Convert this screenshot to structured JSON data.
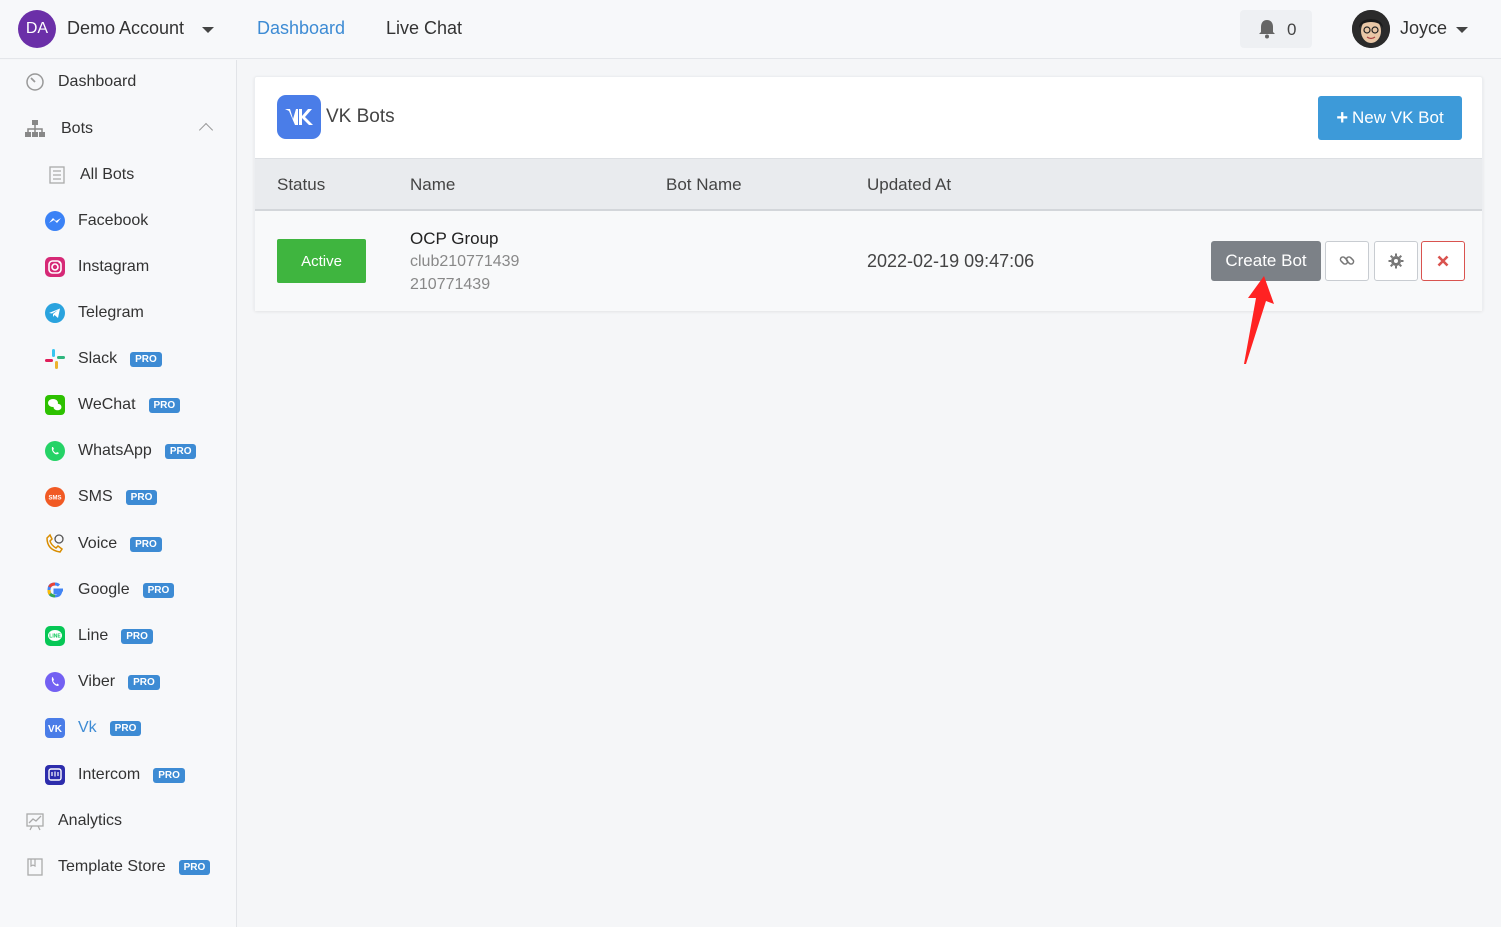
{
  "account": {
    "initials": "DA",
    "name": "Demo Account"
  },
  "topnav": {
    "dashboard": "Dashboard",
    "live_chat": "Live Chat"
  },
  "notifications": {
    "count": "0"
  },
  "user": {
    "name": "Joyce"
  },
  "sidebar": {
    "items": [
      {
        "label": "Dashboard",
        "icon": "dashboard-gauge-icon"
      },
      {
        "label": "Bots",
        "icon": "sitemap-icon"
      },
      {
        "label": "All Bots",
        "icon": "list-icon"
      },
      {
        "label": "Facebook",
        "icon": "messenger-icon"
      },
      {
        "label": "Instagram",
        "icon": "instagram-icon"
      },
      {
        "label": "Telegram",
        "icon": "telegram-icon"
      },
      {
        "label": "Slack",
        "icon": "slack-icon",
        "pro": "PRO"
      },
      {
        "label": "WeChat",
        "icon": "wechat-icon",
        "pro": "PRO"
      },
      {
        "label": "WhatsApp",
        "icon": "whatsapp-icon",
        "pro": "PRO"
      },
      {
        "label": "SMS",
        "icon": "sms-icon",
        "pro": "PRO"
      },
      {
        "label": "Voice",
        "icon": "voice-icon",
        "pro": "PRO"
      },
      {
        "label": "Google",
        "icon": "google-icon",
        "pro": "PRO"
      },
      {
        "label": "Line",
        "icon": "line-icon",
        "pro": "PRO"
      },
      {
        "label": "Viber",
        "icon": "viber-icon",
        "pro": "PRO"
      },
      {
        "label": "Vk",
        "icon": "vk-icon",
        "pro": "PRO"
      },
      {
        "label": "Intercom",
        "icon": "intercom-icon",
        "pro": "PRO"
      },
      {
        "label": "Analytics",
        "icon": "chart-icon"
      },
      {
        "label": "Template Store",
        "icon": "store-icon",
        "pro": "PRO"
      }
    ]
  },
  "panel": {
    "title": "VK Bots",
    "new_button": "New VK Bot",
    "columns": [
      "Status",
      "Name",
      "Bot Name",
      "Updated At"
    ],
    "rows": [
      {
        "status": "Active",
        "name": "OCP Group",
        "sub1": "club210771439",
        "sub2": "210771439",
        "bot_name": "",
        "updated_at": "2022-02-19 09:47:06",
        "action": "Create Bot"
      }
    ]
  },
  "colors": {
    "accent": "#3d8bd4",
    "active_green": "#3fb53f",
    "vk_blue": "#4a7de8",
    "delete_red": "#d9534f"
  }
}
